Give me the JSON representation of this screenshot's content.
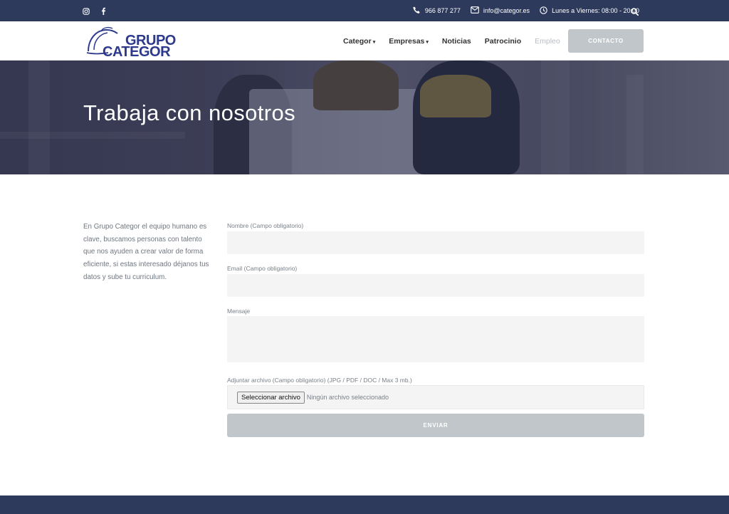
{
  "topbar": {
    "phone": "966 877 277",
    "email": "info@categor.es",
    "hours": "Lunes a Viernes: 08:00 - 20:00"
  },
  "logo": {
    "line1": "GRUPO",
    "line2": "CATEGOR"
  },
  "nav": {
    "items": [
      {
        "label": "Categor",
        "dropdown": true
      },
      {
        "label": "Empresas",
        "dropdown": true
      },
      {
        "label": "Noticias"
      },
      {
        "label": "Patrocinio"
      },
      {
        "label": "Empleo",
        "active": true
      }
    ],
    "contact_label": "CONTACTO"
  },
  "hero": {
    "title": "Trabaja con nosotros"
  },
  "intro": "En Grupo Categor el equipo humano es clave, buscamos personas con talento que nos ayuden a crear valor de forma eficiente, si estas interesado déjanos tus datos y sube tu curriculum.",
  "form": {
    "name_label": "Nombre (Campo obligatorio)",
    "name_value": "",
    "email_label": "Email (Campo obligatorio)",
    "email_value": "",
    "message_label": "Mensaje",
    "message_value": "",
    "file_label": "Adjuntar archivo (Campo obligatorio) (JPG / PDF / DOC / Max 3 mb.)",
    "file_button": "Seleccionar archivo",
    "file_status": "Ningún archivo seleccionado",
    "submit_label": "ENVIAR"
  },
  "colors": {
    "brand": "#2d3a5c",
    "logo_blue": "#2d3a8c",
    "button_gray": "#c0c6ca",
    "field_bg": "#f4f4f4"
  }
}
